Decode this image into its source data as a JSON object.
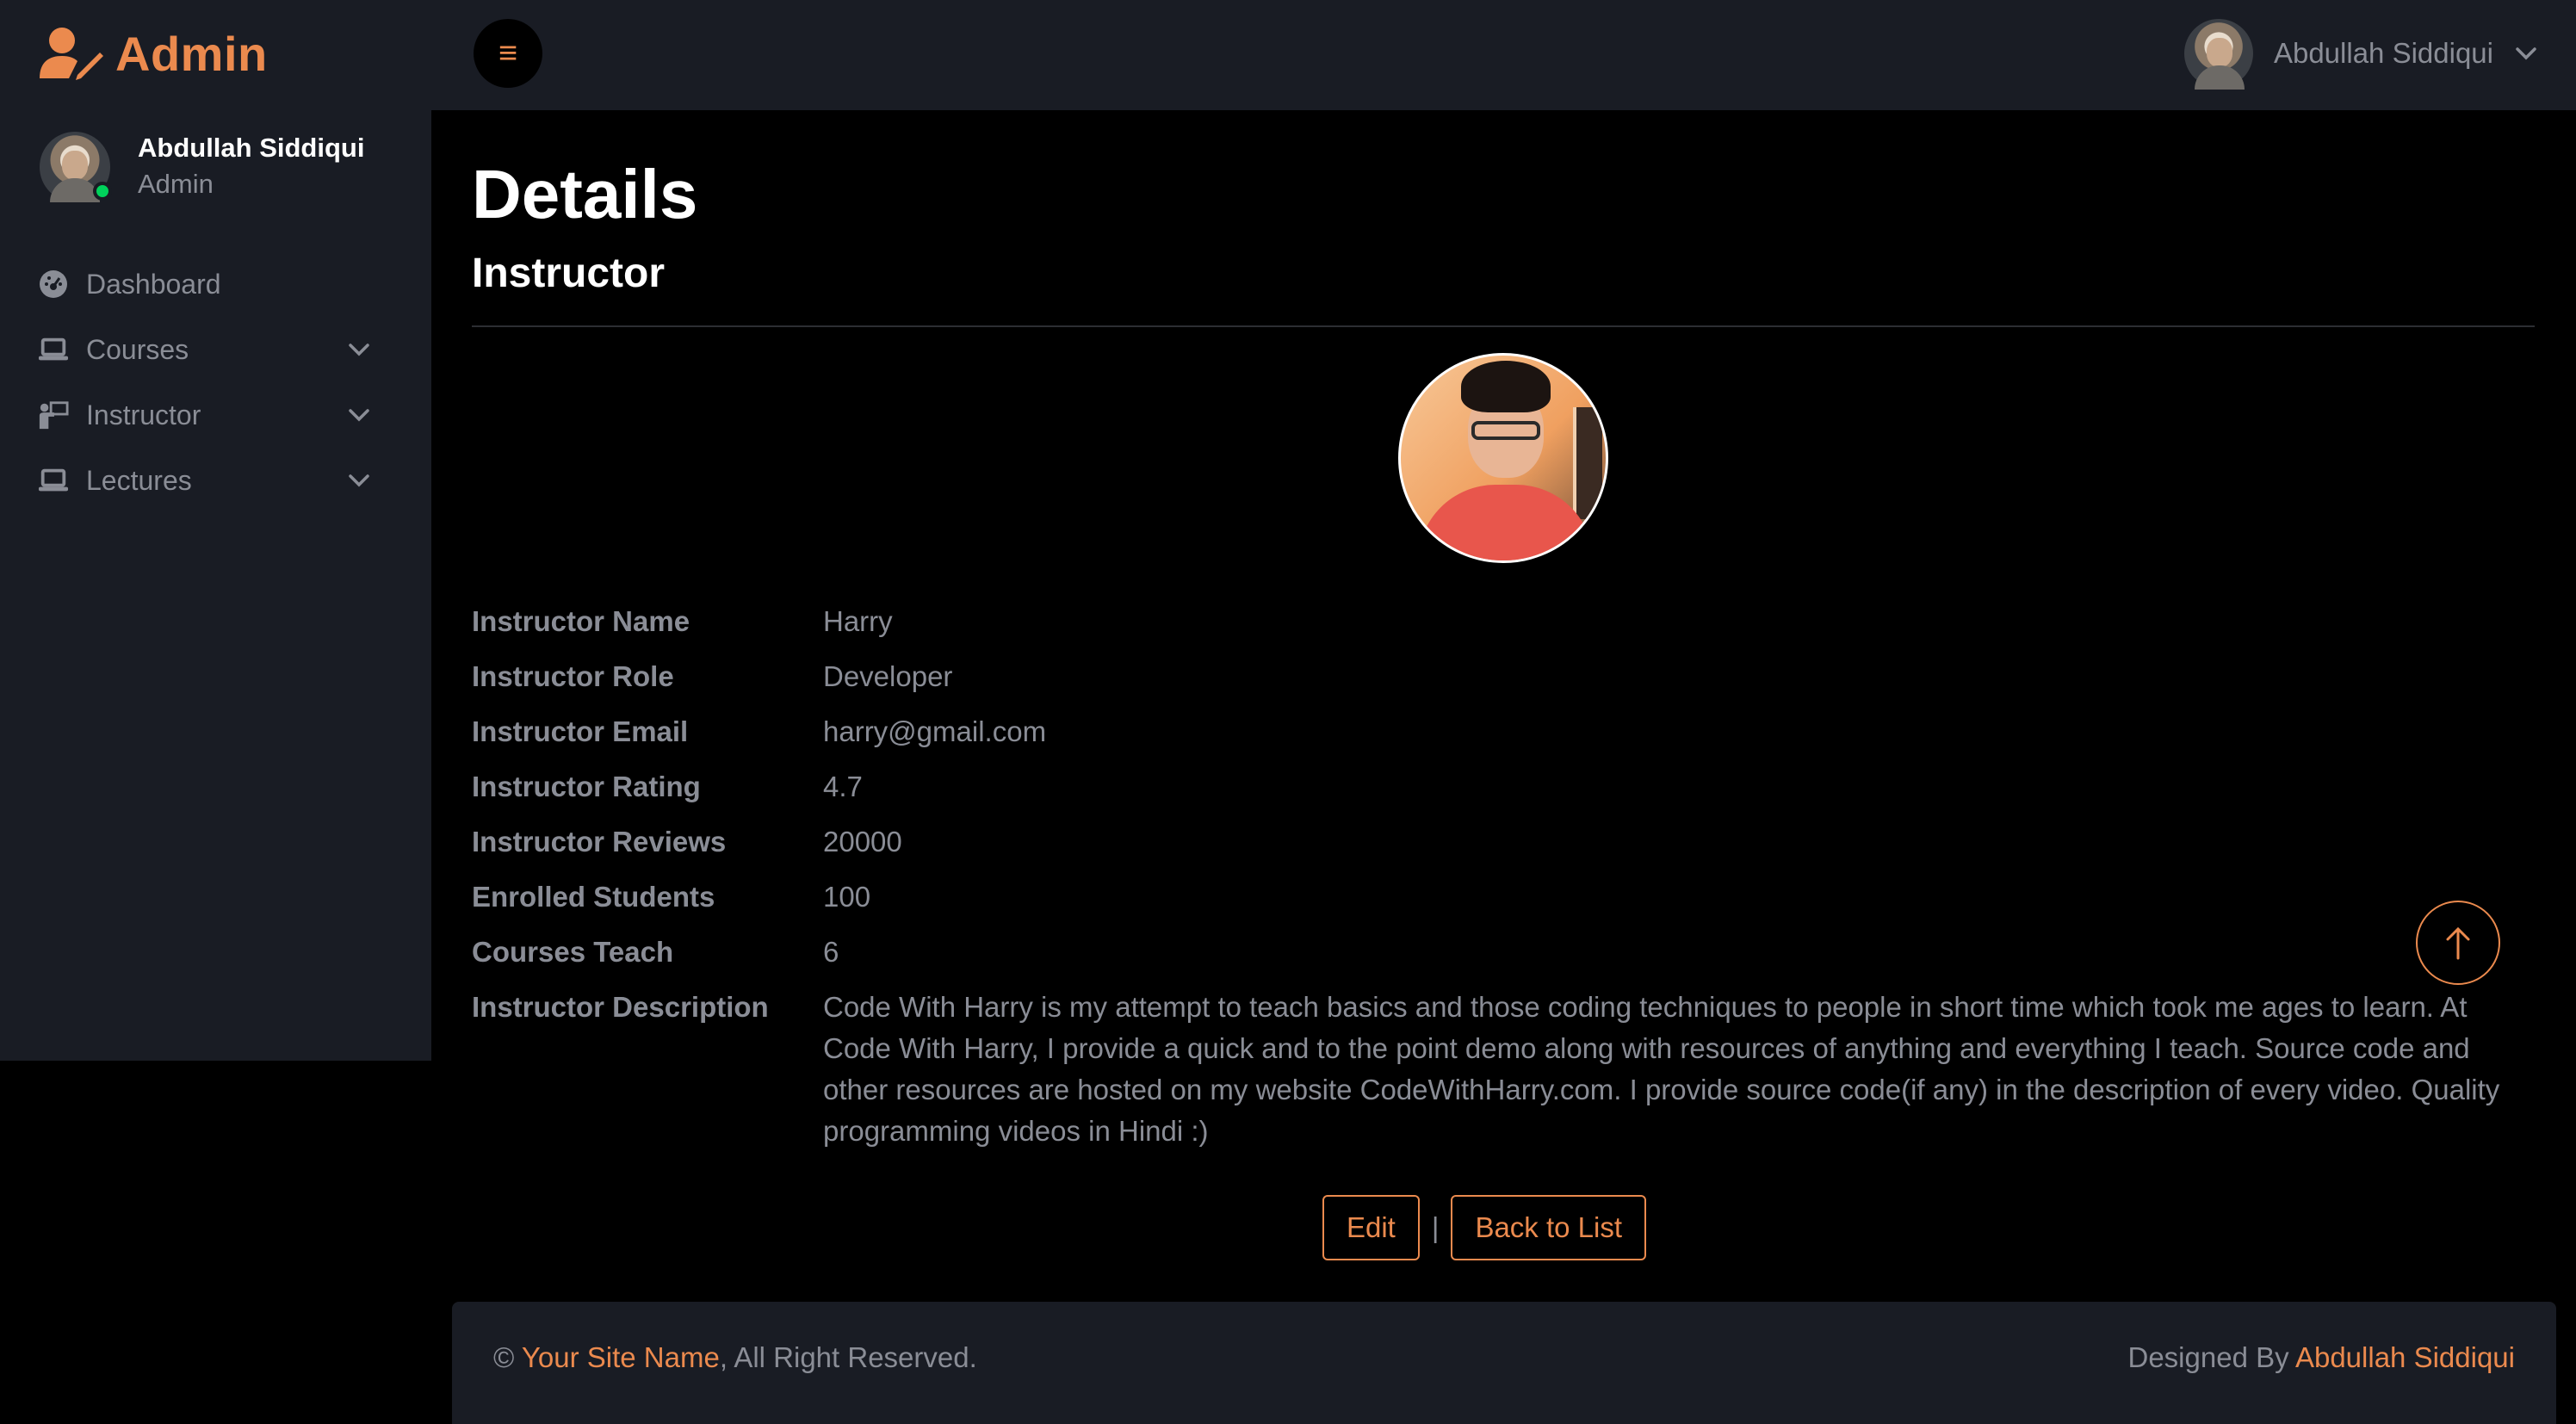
{
  "brand": {
    "name": "Admin"
  },
  "sidebar": {
    "profile": {
      "name": "Abdullah Siddiqui",
      "role": "Admin"
    },
    "items": [
      {
        "label": "Dashboard",
        "icon": "dashboard-icon"
      },
      {
        "label": "Courses",
        "icon": "laptop-icon"
      },
      {
        "label": "Instructor",
        "icon": "instructor-icon"
      },
      {
        "label": "Lectures",
        "icon": "laptop-icon"
      }
    ]
  },
  "topbar": {
    "user_name": "Abdullah Siddiqui",
    "menu_icon": "≡"
  },
  "page": {
    "title": "Details",
    "subtitle": "Instructor"
  },
  "details": [
    {
      "label": "Instructor Name",
      "value": "Harry"
    },
    {
      "label": "Instructor Role",
      "value": "Developer"
    },
    {
      "label": "Instructor Email",
      "value": "harry@gmail.com"
    },
    {
      "label": "Instructor Rating",
      "value": "4.7"
    },
    {
      "label": "Instructor Reviews",
      "value": "20000"
    },
    {
      "label": "Enrolled Students",
      "value": "100"
    },
    {
      "label": "Courses Teach",
      "value": "6"
    },
    {
      "label": "Instructor Description",
      "value": "Code With Harry is my attempt to teach basics and those coding techniques to people in short time which took me ages to learn. At Code With Harry, I provide a quick and to the point demo along with resources of anything and everything I teach. Source code and other resources are hosted on my website CodeWithHarry.com. I provide source code(if any) in the description of every video. Quality programming videos in Hindi :)"
    }
  ],
  "actions": {
    "edit": "Edit",
    "separator": "|",
    "back": "Back to List"
  },
  "footer": {
    "copyright_symbol": "©",
    "site_name": "Your Site Name",
    "rights": ", All Right Reserved.",
    "designed_by": "Designed By",
    "designer": "Abdullah Siddiqui"
  },
  "colors": {
    "accent": "#eb8a4e",
    "sidebar_bg": "#191c24",
    "content_bg": "#000000",
    "muted_text": "#8a8d96",
    "online": "#00d25b"
  }
}
